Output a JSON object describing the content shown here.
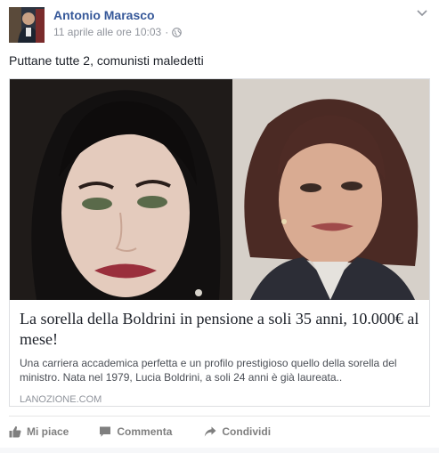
{
  "post": {
    "author": "Antonio Marasco",
    "timestamp": "11 aprile alle ore 10:03",
    "separator": "·",
    "privacy_icon": "globe-icon",
    "message": "Puttane tutte 2, comunisti maledetti"
  },
  "link_card": {
    "title": "La sorella della Boldrini in pensione a soli 35 anni, 10.000€ al mese!",
    "description": "Una carriera accademica perfetta e un profilo prestigioso quello della sorella del ministro. Nata nel 1979, Lucia Boldrini, a soli 24 anni è già laureata..",
    "domain": "LANOZIONE.COM"
  },
  "actions": {
    "like_label": "Mi piace",
    "comment_label": "Commenta",
    "share_label": "Condividi"
  },
  "colors": {
    "author_link": "#365899",
    "meta_text": "#90949c",
    "action_text": "#7f7f7f",
    "card_border": "#dddfe2"
  }
}
